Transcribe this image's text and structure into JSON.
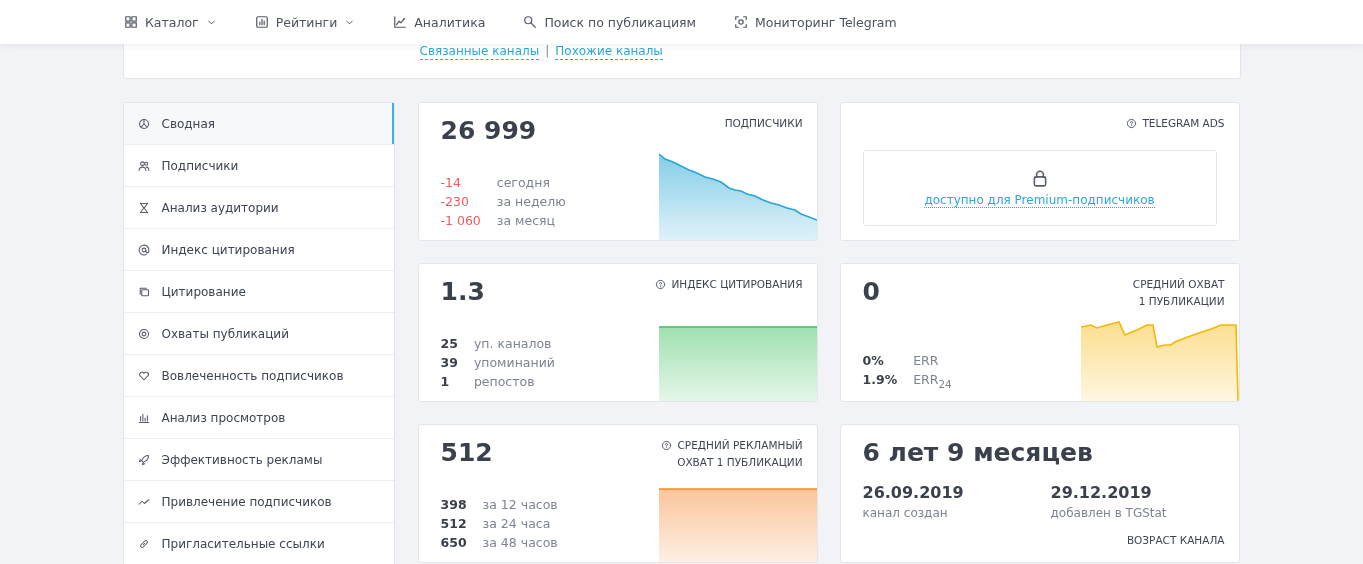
{
  "nav": [
    {
      "label": "Каталог",
      "dropdown": true
    },
    {
      "label": "Рейтинги",
      "dropdown": true
    },
    {
      "label": "Аналитика",
      "dropdown": false
    },
    {
      "label": "Поиск по публикациям",
      "dropdown": false
    },
    {
      "label": "Мониторинг Telegram",
      "dropdown": false
    }
  ],
  "channel_links": {
    "items": [
      "Связанные каналы",
      "Похожие каналы"
    ],
    "separator": "|"
  },
  "sidebar": {
    "items": [
      {
        "label": "Сводная",
        "selected": true
      },
      {
        "label": "Подписчики",
        "selected": false
      },
      {
        "label": "Анализ аудитории",
        "selected": false
      },
      {
        "label": "Индекс цитирования",
        "selected": false
      },
      {
        "label": "Цитирование",
        "selected": false
      },
      {
        "label": "Охваты публикаций",
        "selected": false
      },
      {
        "label": "Вовлеченность подписчиков",
        "selected": false
      },
      {
        "label": "Анализ просмотров",
        "selected": false
      },
      {
        "label": "Эффективность рекламы",
        "selected": false
      },
      {
        "label": "Привлечение подписчиков",
        "selected": false
      },
      {
        "label": "Пригласительные ссылки",
        "selected": false
      }
    ]
  },
  "cards": [
    {
      "kind": "falling",
      "negative": true,
      "value": "26 999",
      "title": [
        "ПОДПИСЧИКИ"
      ],
      "help": false,
      "stats": [
        {
          "value": "-14",
          "label": "сегодня"
        },
        {
          "value": "-230",
          "label": "за неделю"
        },
        {
          "value": "-1 060",
          "label": "за месяц"
        }
      ]
    },
    {
      "kind": "locked",
      "title": [
        "TELEGRAM ADS"
      ],
      "help": true,
      "link": "доступно для Premium-подписчиков"
    },
    {
      "kind": "flat-green",
      "negative": false,
      "value": "1.3",
      "title": [
        "ИНДЕКС ЦИТИРОВАНИЯ"
      ],
      "help": true,
      "stats": [
        {
          "value": "25",
          "label": "уп. каналов"
        },
        {
          "value": "39",
          "label": "упоминаний"
        },
        {
          "value": "1",
          "label": "репостов"
        }
      ]
    },
    {
      "kind": "jagged",
      "negative": false,
      "value": "0",
      "title": [
        "СРЕДНИЙ ОХВАТ",
        "1 ПУБЛИКАЦИИ"
      ],
      "help": false,
      "stats": [
        {
          "value": "0%",
          "label": "ERR"
        },
        {
          "value": "1.9%",
          "label": "ERR$_{24}$"
        }
      ]
    },
    {
      "kind": "flat-orange",
      "negative": false,
      "value": "512",
      "title": [
        "СРЕДНИЙ РЕКЛАМНЫЙ",
        "ОХВАТ 1 ПУБЛИКАЦИИ"
      ],
      "help": true,
      "stats": [
        {
          "value": "398",
          "label": "за 12 часов"
        },
        {
          "value": "512",
          "label": "за 24 часа"
        },
        {
          "value": "650",
          "label": "за 48 часов"
        }
      ]
    },
    {
      "kind": "age",
      "value": "6 лет 9 месяцев",
      "dates": [
        {
          "value": "26.09.2019",
          "label": "канал создан"
        },
        {
          "value": "29.12.2019",
          "label": "добавлен в TGStat"
        }
      ],
      "footer": "ВОЗРАСТ КАНАЛА"
    }
  ]
}
